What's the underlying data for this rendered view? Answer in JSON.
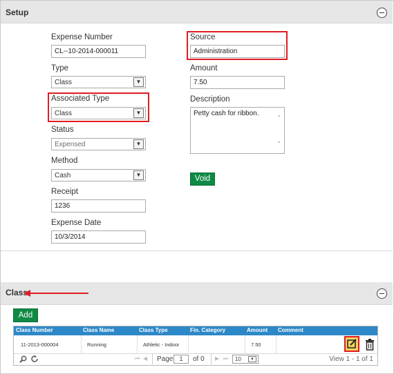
{
  "setup": {
    "title": "Setup",
    "fields": {
      "expense_number": {
        "label": "Expense Number",
        "value": "CL--10-2014-000011"
      },
      "type": {
        "label": "Type",
        "value": "Class"
      },
      "associated_type": {
        "label": "Associated Type",
        "value": "Class"
      },
      "status": {
        "label": "Status",
        "value": "Expensed"
      },
      "method": {
        "label": "Method",
        "value": "Cash"
      },
      "receipt": {
        "label": "Receipt",
        "value": "1236"
      },
      "expense_date": {
        "label": "Expense Date",
        "value": "10/3/2014"
      },
      "source": {
        "label": "Source",
        "value": "Administration"
      },
      "amount": {
        "label": "Amount",
        "value": "7.50"
      },
      "description": {
        "label": "Description",
        "value": "Petty cash for ribbon."
      }
    },
    "void_label": "Void"
  },
  "class_section": {
    "title": "Class",
    "add_label": "Add",
    "columns": [
      "Class Number",
      "Class Name",
      "Class Type",
      "Fin. Category",
      "Amount",
      "Comment"
    ],
    "rows": [
      {
        "class_number": "11-2013-000004",
        "class_name": "Running",
        "class_type": "Athletic - Indoor",
        "fin_category": "",
        "amount": "7.50",
        "comment": ""
      }
    ],
    "pager": {
      "page_label": "Page",
      "page_value": "1",
      "of_label": "of 0",
      "page_size": "10",
      "view_text": "View 1 - 1 of 1"
    }
  },
  "accent": {
    "red": "#e01b22",
    "green": "#0f8a45",
    "grid_header": "#2d88c8"
  },
  "icons": [
    "collapse-icon",
    "dropdown-arrow-icon",
    "edit-icon",
    "trash-icon",
    "search-icon",
    "refresh-icon",
    "red-arrow-annotation"
  ]
}
